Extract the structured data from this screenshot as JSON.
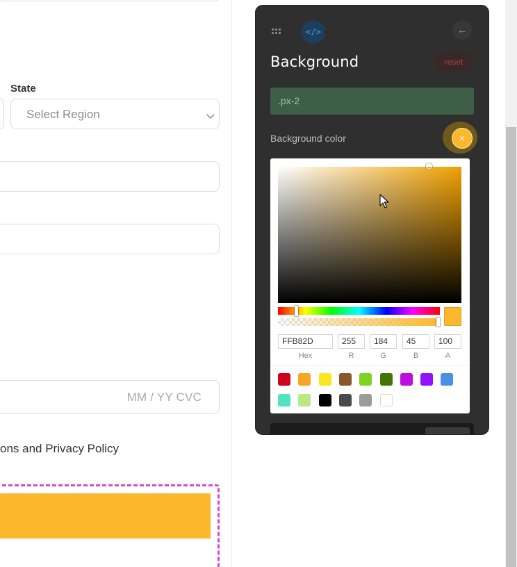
{
  "form": {
    "state_label": "State",
    "state_select_value": "Select Region",
    "card_placeholder": "MM / YY  CVC",
    "terms_text": "ons and Privacy Policy"
  },
  "panel": {
    "title": "Background",
    "reset_label": "reset",
    "selector": ".px-2",
    "background_color_label": "Background color",
    "close_symbol": "×",
    "back_symbol": "←",
    "code_symbol": "</>"
  },
  "picker": {
    "hex": "FFB82D",
    "r": "255",
    "g": "184",
    "b": "45",
    "a": "100",
    "labels": {
      "hex": "Hex",
      "r": "R",
      "g": "G",
      "b": "B",
      "a": "A"
    },
    "presets": [
      "#d0021b",
      "#f5a623",
      "#f8e71c",
      "#8b572a",
      "#7ed321",
      "#417505",
      "#bd10e0",
      "#9013fe",
      "#4a90e2",
      "#50e3c2",
      "#b8e986",
      "#000000",
      "#4a4a4a",
      "#9b9b9b",
      "#ffffff"
    ]
  },
  "colors": {
    "selected_color": "#fbb82d",
    "highlight_frame": "#d946d6",
    "panel_bg": "#2f2f2f"
  }
}
